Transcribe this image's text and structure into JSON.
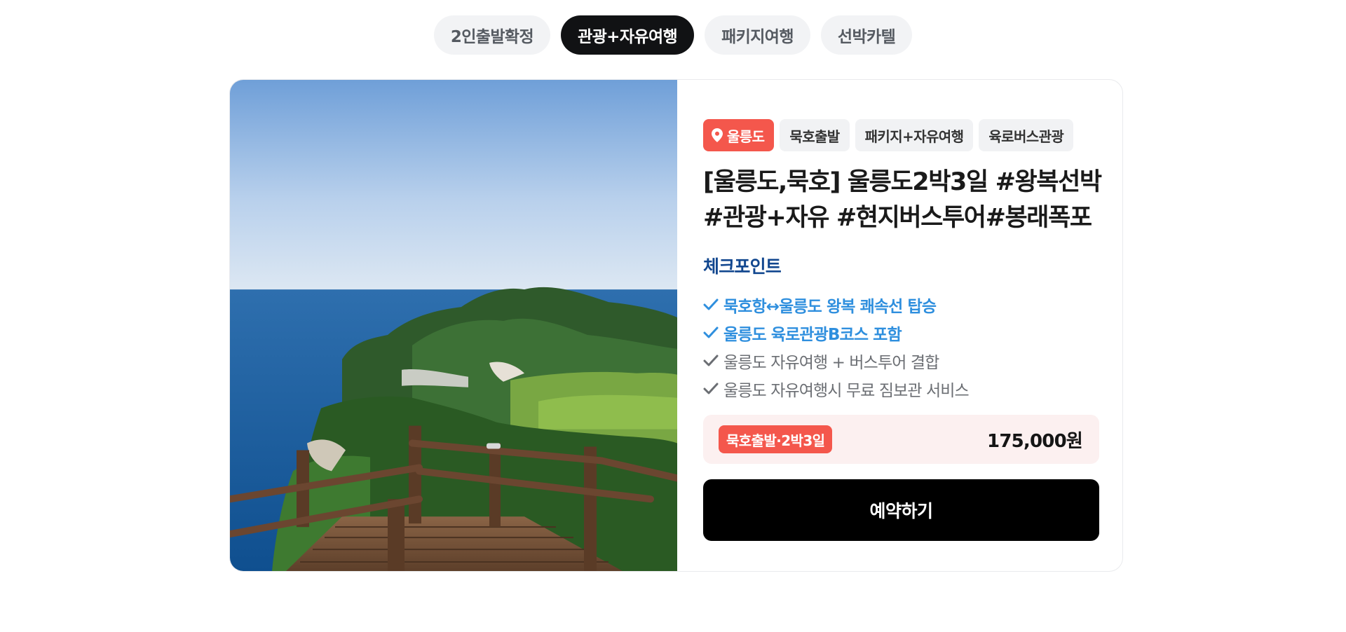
{
  "tabs": [
    {
      "label": "2인출발확정",
      "active": false
    },
    {
      "label": "관광+자유여행",
      "active": true
    },
    {
      "label": "패키지여행",
      "active": false
    },
    {
      "label": "선박카텔",
      "active": false
    }
  ],
  "product": {
    "tags": {
      "location": "울릉도",
      "departure": "묵호출발",
      "type": "패키지+자유여행",
      "tour": "육로버스관광"
    },
    "title": "[울릉도,묵호] 울릉도2박3일 #왕복선박 #관광+자유 #현지버스투어#봉래폭포",
    "checkpoint_heading": "체크포인트",
    "checkpoints": [
      {
        "text": "묵호항↔울릉도 왕복 쾌속선 탑승",
        "highlight": true
      },
      {
        "text": "울릉도 육로관광B코스 포함",
        "highlight": true
      },
      {
        "text": "울릉도 자유여행 + 버스투어 결합",
        "highlight": false
      },
      {
        "text": "울릉도 자유여행시 무료 짐보관 서비스",
        "highlight": false
      }
    ],
    "price_option": "묵호출발·2박3일",
    "price": "175,000원",
    "book_label": "예약하기"
  },
  "colors": {
    "accent": "#f4574c",
    "checkpoint_heading": "#12478f",
    "highlight": "#2f8fde",
    "price_bg": "#fcf0f0",
    "book_bg": "#000000"
  },
  "icons": {
    "location": "map-pin-icon",
    "check": "check-icon"
  }
}
